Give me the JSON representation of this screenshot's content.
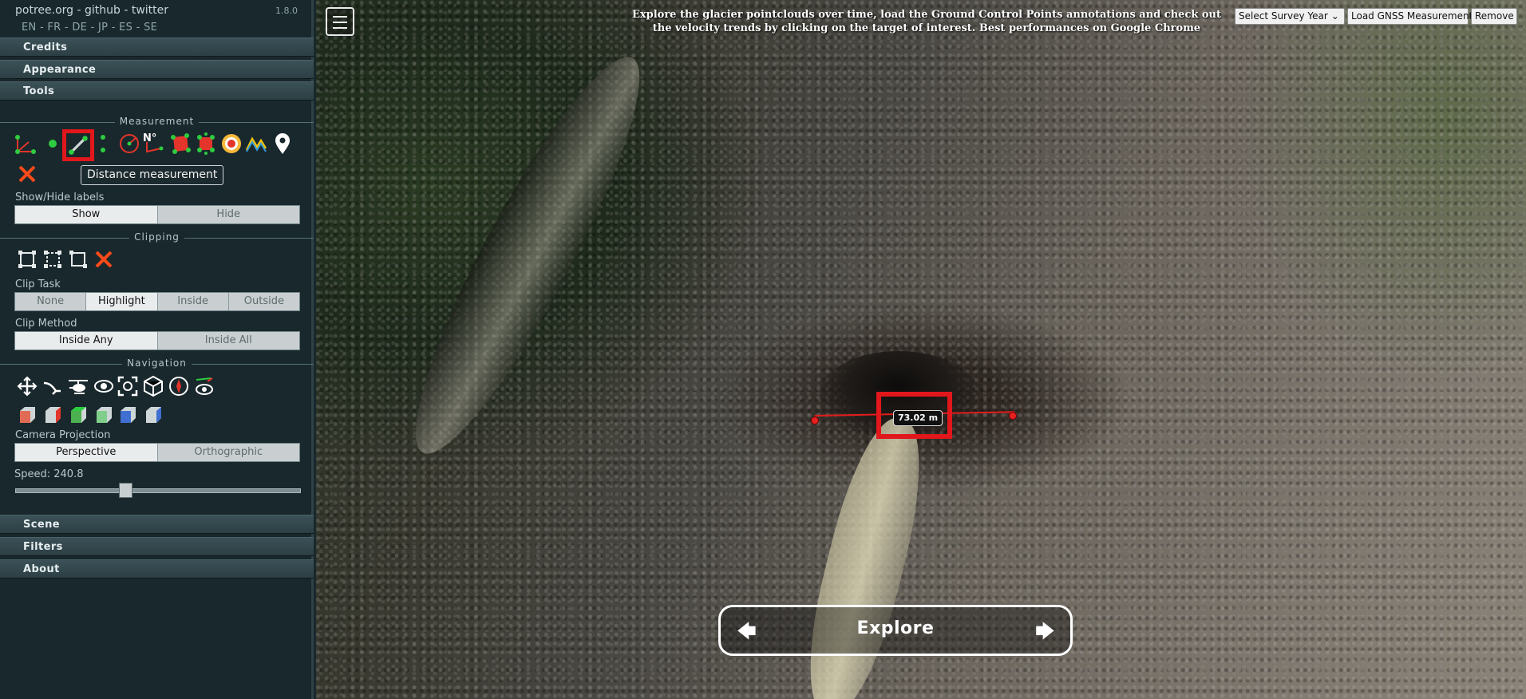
{
  "header": {
    "links": "potree.org - github - twitter",
    "version": "1.8.0",
    "languages": "EN - FR - DE - JP - ES - SE"
  },
  "accordion": {
    "credits": "Credits",
    "appearance": "Appearance",
    "tools": "Tools",
    "scene": "Scene",
    "filters": "Filters",
    "about": "About"
  },
  "measurement": {
    "title": "Measurement",
    "tooltip": "Distance measurement",
    "tools": [
      "angle-icon",
      "point-icon",
      "distance-icon",
      "height-icon",
      "circle-icon",
      "azimuth-icon",
      "area-icon",
      "volume-icon",
      "sphere-volume-icon",
      "height-profile-icon",
      "annotation-icon",
      "remove-all-icon"
    ],
    "labels_title": "Show/Hide labels",
    "show": "Show",
    "hide": "Hide"
  },
  "clipping": {
    "title": "Clipping",
    "tools": [
      "clip-volume-icon",
      "clip-polygon-icon",
      "clip-screen-box-icon",
      "remove-clipping-icon"
    ],
    "task_label": "Clip Task",
    "task_options": [
      "None",
      "Highlight",
      "Inside",
      "Outside"
    ],
    "task_selected": "Highlight",
    "method_label": "Clip Method",
    "method_options": [
      "Inside Any",
      "Inside All"
    ],
    "method_selected": "Inside Any"
  },
  "navigation": {
    "title": "Navigation",
    "controls": [
      "earth-control-icon",
      "fly-control-icon",
      "helicopter-control-icon",
      "orbit-control-icon",
      "focus-icon",
      "navcube-icon",
      "compass-icon",
      "camera-animation-icon"
    ],
    "views": [
      "left-view-icon",
      "front-view-icon",
      "top-view-icon",
      "bottom-view-icon",
      "back-view-icon",
      "right-view-icon"
    ],
    "projection_label": "Camera Projection",
    "projection_options": [
      "Perspective",
      "Orthographic"
    ],
    "projection_selected": "Perspective",
    "speed_label": "Speed: 240.8",
    "speed_fraction": 0.38
  },
  "viewer": {
    "banner": "Explore the glacier pointclouds over time, load the Ground Control Points annotations and check out the velocity trends by clicking on the target of interest. Best performances on Google Chrome",
    "survey_select": "Select Survey Year",
    "load_gnss": "Load GNSS Measurements",
    "remove": "Remove",
    "measurement_label": "73.02 m",
    "explore": "Explore",
    "prev_arrow": "🡄",
    "next_arrow": "🡆"
  },
  "colors": {
    "sidebar_bg": "#19282c",
    "accent_red": "#e1171b",
    "tool_green": "#2ecc40"
  }
}
